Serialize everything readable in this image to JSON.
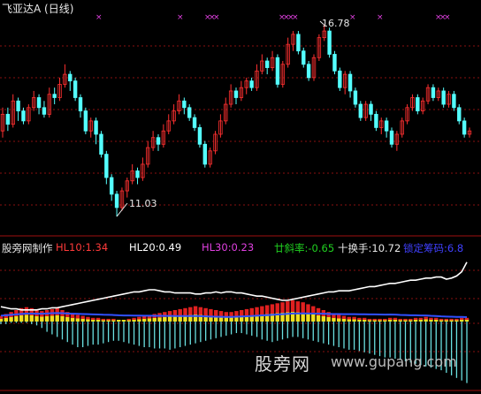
{
  "window": {
    "title": "飞亚达A (日线)"
  },
  "price_chart": {
    "high_label": "16.78",
    "low_label": "11.03",
    "candles": [
      [
        13.6,
        14.1,
        14.3,
        13.4
      ],
      [
        14.1,
        13.8,
        14.3,
        13.6
      ],
      [
        13.8,
        14.5,
        14.7,
        13.7
      ],
      [
        14.5,
        14.2,
        14.6,
        13.9
      ],
      [
        14.2,
        13.9,
        14.3,
        13.8
      ],
      [
        13.9,
        14.3,
        14.4,
        13.8
      ],
      [
        14.3,
        14.6,
        14.8,
        14.2
      ],
      [
        14.6,
        14.3,
        14.7,
        14.1
      ],
      [
        14.3,
        14.1,
        14.5,
        14.0
      ],
      [
        14.1,
        14.7,
        14.9,
        14.0
      ],
      [
        14.7,
        14.6,
        14.9,
        14.4
      ],
      [
        14.6,
        15.0,
        15.2,
        14.5
      ],
      [
        15.0,
        15.3,
        15.6,
        14.9
      ],
      [
        15.3,
        15.1,
        15.4,
        14.8
      ],
      [
        15.1,
        14.6,
        15.2,
        14.5
      ],
      [
        14.6,
        14.2,
        14.7,
        14.0
      ],
      [
        14.2,
        13.6,
        14.3,
        13.5
      ],
      [
        13.6,
        13.9,
        14.0,
        13.4
      ],
      [
        13.9,
        13.5,
        14.0,
        13.2
      ],
      [
        13.5,
        12.9,
        13.6,
        12.8
      ],
      [
        12.9,
        12.2,
        13.0,
        12.0
      ],
      [
        12.2,
        11.7,
        12.3,
        11.5
      ],
      [
        11.7,
        11.3,
        11.8,
        11.03
      ],
      [
        11.3,
        11.8,
        11.9,
        11.2
      ],
      [
        11.8,
        12.1,
        12.2,
        11.6
      ],
      [
        12.1,
        12.4,
        12.6,
        12.0
      ],
      [
        12.4,
        12.2,
        12.5,
        12.0
      ],
      [
        12.2,
        12.6,
        12.8,
        12.1
      ],
      [
        12.6,
        13.1,
        13.3,
        12.5
      ],
      [
        13.1,
        13.4,
        13.6,
        13.0
      ],
      [
        13.4,
        13.2,
        13.5,
        13.0
      ],
      [
        13.2,
        13.6,
        13.8,
        13.1
      ],
      [
        13.6,
        13.9,
        14.1,
        13.5
      ],
      [
        13.9,
        14.2,
        14.4,
        13.8
      ],
      [
        14.2,
        14.5,
        14.7,
        14.1
      ],
      [
        14.5,
        14.3,
        14.6,
        14.1
      ],
      [
        14.3,
        14.0,
        14.4,
        13.9
      ],
      [
        14.0,
        13.7,
        14.1,
        13.6
      ],
      [
        13.7,
        13.2,
        13.8,
        13.1
      ],
      [
        13.2,
        12.6,
        13.3,
        12.5
      ],
      [
        12.6,
        13.0,
        13.1,
        12.5
      ],
      [
        13.0,
        13.5,
        13.6,
        12.9
      ],
      [
        13.5,
        13.9,
        14.1,
        13.4
      ],
      [
        13.9,
        14.4,
        14.6,
        13.8
      ],
      [
        14.4,
        14.8,
        15.0,
        14.3
      ],
      [
        14.8,
        14.6,
        14.9,
        14.4
      ],
      [
        14.6,
        14.9,
        15.1,
        14.5
      ],
      [
        14.9,
        15.1,
        15.2,
        14.7
      ],
      [
        15.1,
        14.9,
        15.2,
        14.8
      ],
      [
        14.9,
        15.4,
        15.6,
        14.8
      ],
      [
        15.4,
        15.7,
        15.9,
        15.3
      ],
      [
        15.7,
        15.5,
        15.8,
        15.3
      ],
      [
        15.5,
        15.8,
        16.0,
        15.4
      ],
      [
        15.8,
        15.0,
        15.9,
        14.9
      ],
      [
        15.0,
        15.6,
        15.7,
        14.9
      ],
      [
        15.6,
        16.2,
        16.4,
        15.5
      ],
      [
        16.2,
        16.5,
        16.6,
        16.0
      ],
      [
        16.5,
        16.0,
        16.6,
        15.9
      ],
      [
        16.0,
        15.6,
        16.1,
        15.5
      ],
      [
        15.6,
        15.2,
        15.7,
        15.1
      ],
      [
        15.2,
        15.8,
        15.9,
        15.1
      ],
      [
        15.8,
        16.4,
        16.5,
        15.7
      ],
      [
        16.4,
        16.6,
        16.78,
        16.3
      ],
      [
        16.6,
        15.9,
        16.7,
        15.8
      ],
      [
        15.9,
        15.4,
        16.0,
        15.3
      ],
      [
        15.4,
        14.9,
        15.5,
        14.8
      ],
      [
        14.9,
        15.3,
        15.4,
        14.7
      ],
      [
        15.3,
        14.8,
        15.4,
        14.6
      ],
      [
        14.8,
        14.4,
        14.9,
        14.3
      ],
      [
        14.4,
        14.0,
        14.5,
        13.9
      ],
      [
        14.0,
        14.4,
        14.5,
        13.9
      ],
      [
        14.4,
        14.1,
        14.5,
        13.9
      ],
      [
        14.1,
        13.7,
        14.2,
        13.6
      ],
      [
        13.7,
        13.9,
        14.0,
        13.5
      ],
      [
        13.9,
        13.6,
        14.0,
        13.4
      ],
      [
        13.6,
        13.2,
        13.7,
        13.1
      ],
      [
        13.2,
        13.5,
        13.6,
        13.0
      ],
      [
        13.5,
        13.9,
        14.0,
        13.4
      ],
      [
        13.9,
        14.3,
        14.4,
        13.8
      ],
      [
        14.3,
        14.6,
        14.7,
        14.2
      ],
      [
        14.6,
        14.2,
        14.7,
        14.1
      ],
      [
        14.2,
        14.5,
        14.6,
        14.1
      ],
      [
        14.5,
        14.9,
        15.0,
        14.4
      ],
      [
        14.9,
        14.6,
        15.0,
        14.5
      ],
      [
        14.6,
        14.8,
        14.9,
        14.5
      ],
      [
        14.8,
        14.4,
        14.9,
        14.3
      ],
      [
        14.4,
        14.7,
        14.8,
        14.3
      ],
      [
        14.7,
        14.3,
        14.8,
        14.2
      ],
      [
        14.3,
        13.9,
        14.4,
        13.8
      ],
      [
        13.9,
        13.5,
        14.0,
        13.4
      ],
      [
        13.5,
        13.6,
        13.7,
        13.4
      ]
    ]
  },
  "indicator": {
    "source": "股旁网制作",
    "items": [
      {
        "text": "HL10:1.34",
        "color": "#ff3a3a"
      },
      {
        "text": "HL20:0.49",
        "color": "#ffffff"
      },
      {
        "text": "HL30:0.23",
        "color": "#e040e0"
      },
      {
        "text": "廿斜率:-0.65",
        "color": "#20d020"
      },
      {
        "text": "十换手:10.72",
        "color": "#e8e8e8"
      },
      {
        "text": "锁定筹码:6.8",
        "color": "#4040ff"
      }
    ],
    "white_line": [
      14,
      13,
      12,
      12,
      11,
      11,
      11,
      11,
      12,
      12,
      13,
      13,
      14,
      15,
      16,
      17,
      18,
      19,
      20,
      21,
      22,
      23,
      24,
      25,
      26,
      27,
      28,
      28,
      29,
      30,
      30,
      29,
      28,
      28,
      27,
      27,
      27,
      27,
      26,
      26,
      27,
      27,
      28,
      27,
      28,
      28,
      27,
      27,
      26,
      25,
      24,
      24,
      23,
      22,
      21,
      20,
      20,
      21,
      22,
      23,
      24,
      25,
      26,
      27,
      28,
      28,
      29,
      29,
      29,
      30,
      31,
      32,
      33,
      33,
      34,
      35,
      36,
      36,
      37,
      38,
      39,
      39,
      40,
      41,
      41,
      42,
      42,
      40,
      41,
      43,
      47,
      56
    ],
    "cyan_bars": [
      2,
      2,
      1,
      1,
      1,
      1,
      2,
      3,
      5,
      8,
      10,
      12,
      14,
      16,
      18,
      20,
      20,
      19,
      18,
      18,
      17,
      16,
      15,
      15,
      16,
      17,
      18,
      19,
      20,
      20,
      21,
      21,
      21,
      22,
      21,
      20,
      19,
      18,
      17,
      16,
      15,
      14,
      13,
      12,
      11,
      10,
      9,
      9,
      10,
      11,
      12,
      14,
      15,
      16,
      15,
      14,
      13,
      12,
      12,
      13,
      14,
      15,
      16,
      17,
      18,
      19,
      20,
      21,
      22,
      22,
      23,
      24,
      25,
      26,
      27,
      28,
      28,
      29,
      30,
      31,
      32,
      33,
      34,
      35,
      36,
      37,
      38,
      40,
      42,
      44,
      46,
      48
    ],
    "red_bars": [
      4,
      6,
      8,
      10,
      12,
      13,
      12,
      10,
      9,
      10,
      11,
      12,
      10,
      8,
      6,
      5,
      4,
      3,
      2,
      2,
      1,
      1,
      1,
      0,
      0,
      1,
      2,
      3,
      4,
      5,
      6,
      7,
      8,
      9,
      10,
      11,
      12,
      13,
      14,
      13,
      12,
      11,
      10,
      9,
      8,
      8,
      9,
      10,
      11,
      12,
      13,
      14,
      15,
      16,
      17,
      18,
      19,
      20,
      19,
      18,
      16,
      14,
      12,
      10,
      8,
      6,
      5,
      4,
      3,
      3,
      2,
      2,
      1,
      1,
      1,
      1,
      2,
      2,
      1,
      1,
      1,
      2,
      2,
      3,
      2,
      2,
      1,
      1,
      1,
      1,
      2,
      2
    ]
  },
  "markers": {
    "count_label": "×"
  },
  "watermark": {
    "cn": "股旁网",
    "url": "www.gupang.com"
  }
}
